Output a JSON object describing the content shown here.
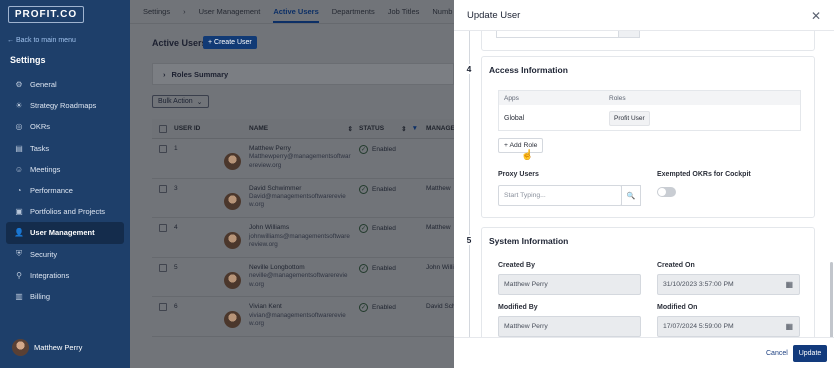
{
  "brand": {
    "logo_text": "PROFIT.CO"
  },
  "sidebar": {
    "back_link": "← Back to main menu",
    "section_title": "Settings",
    "items": [
      {
        "label": "General",
        "icon": "gear-icon"
      },
      {
        "label": "Strategy Roadmaps",
        "icon": "bulb-icon"
      },
      {
        "label": "OKRs",
        "icon": "target-icon"
      },
      {
        "label": "Tasks",
        "icon": "clipboard-icon"
      },
      {
        "label": "Meetings",
        "icon": "people-icon"
      },
      {
        "label": "Performance",
        "icon": "gauge-icon"
      },
      {
        "label": "Portfolios and Projects",
        "icon": "briefcase-icon"
      },
      {
        "label": "User Management",
        "icon": "user-icon",
        "active": true
      },
      {
        "label": "Security",
        "icon": "shield-icon"
      },
      {
        "label": "Integrations",
        "icon": "plug-icon"
      },
      {
        "label": "Billing",
        "icon": "billing-icon"
      }
    ],
    "current_user": "Matthew Perry"
  },
  "topnav": {
    "breadcrumb_root": "Settings",
    "breadcrumb_sep": "›",
    "breadcrumb_current": "User Management",
    "tabs": [
      "Active Users",
      "Departments",
      "Job Titles",
      "Numb"
    ]
  },
  "users_page": {
    "title": "Active Users",
    "create_label": "+ Create User",
    "roles_summary": "Roles Summary",
    "bulk_action": "Bulk Action",
    "columns": [
      "USER ID",
      "NAME",
      "STATUS",
      "MANAGE"
    ],
    "rows": [
      {
        "id": "1",
        "name": "Matthew Perry",
        "email": "Matthewperry@managementsoftwarereview.org",
        "status": "Enabled",
        "manager": ""
      },
      {
        "id": "3",
        "name": "David Schwimmer",
        "email": "David@managementsoftwarereview.org",
        "status": "Enabled",
        "manager": "Matthew"
      },
      {
        "id": "4",
        "name": "John Williams",
        "email": "johnwilliams@managementsoftwarereview.org",
        "status": "Enabled",
        "manager": "Matthew"
      },
      {
        "id": "5",
        "name": "Neville Longbottom",
        "email": "neville@managementsoftwarereview.org",
        "status": "Enabled",
        "manager": "John Willi"
      },
      {
        "id": "6",
        "name": "Vivian Kent",
        "email": "vivian@managementsoftwarereview.org",
        "status": "Enabled",
        "manager": "David Sch"
      }
    ]
  },
  "panel": {
    "title": "Update User",
    "access": {
      "step": "4",
      "title": "Access Information",
      "table_headers": [
        "Apps",
        "Roles"
      ],
      "table_rows": [
        {
          "app": "Global",
          "role": "Profit User"
        }
      ],
      "add_role_label": "+ Add Role",
      "proxy_label": "Proxy Users",
      "proxy_placeholder": "Start Typing...",
      "exempted_label": "Exempted OKRs for Cockpit",
      "exempted_on": false
    },
    "system": {
      "step": "5",
      "title": "System Information",
      "created_by_label": "Created By",
      "created_by": "Matthew Perry",
      "created_on_label": "Created On",
      "created_on": "31/10/2023 3:57:00 PM",
      "modified_by_label": "Modified By",
      "modified_by": "Matthew Perry",
      "modified_on_label": "Modified On",
      "modified_on": "17/07/2024 5:59:00 PM"
    },
    "cancel_label": "Cancel",
    "update_label": "Update"
  }
}
